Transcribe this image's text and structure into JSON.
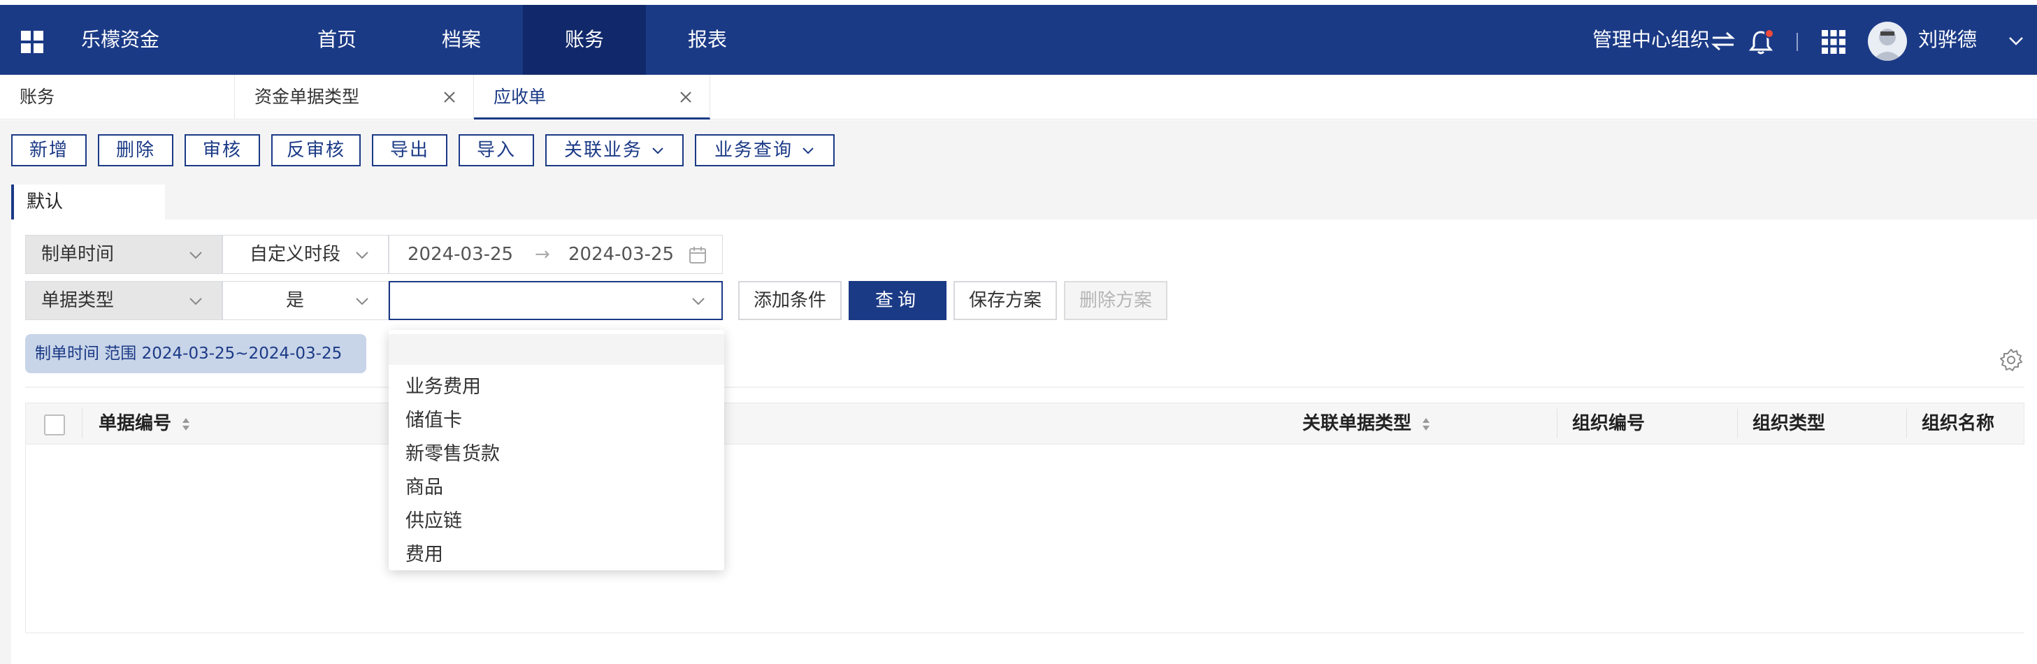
{
  "topbar": {
    "brand": "乐檬资金",
    "nav": [
      {
        "label": "首页",
        "active": false
      },
      {
        "label": "档案",
        "active": false
      },
      {
        "label": "账务",
        "active": true
      },
      {
        "label": "报表",
        "active": false
      }
    ],
    "org": "管理中心组织",
    "username": "刘骅德",
    "icons": [
      "grid-menu-icon",
      "swap-icon",
      "bell-icon",
      "apps-icon",
      "avatar",
      "chevron-down-icon"
    ],
    "colors": {
      "bar": "#1b3a86",
      "active": "#11296a",
      "badge": "#f04a3a"
    }
  },
  "tabs": [
    {
      "label": "账务",
      "closable": false,
      "active": false
    },
    {
      "label": "资金单据类型",
      "closable": true,
      "active": false
    },
    {
      "label": "应收单",
      "closable": true,
      "active": true
    }
  ],
  "toolbar": {
    "buttons": [
      "新增",
      "删除",
      "审核",
      "反审核",
      "导出",
      "导入"
    ],
    "dropdowns": [
      "关联业务",
      "业务查询"
    ]
  },
  "scheme": {
    "label": "默认"
  },
  "filters": {
    "row1": {
      "field": "制单时间",
      "operator": "自定义时段",
      "date_start": "2024-03-25",
      "date_end": "2024-03-25",
      "arrow": "→"
    },
    "row2": {
      "field": "单据类型",
      "operator": "是",
      "value": ""
    },
    "buttons": {
      "add": "添加条件",
      "query": "查询",
      "save": "保存方案",
      "delete": "删除方案"
    },
    "chip": "制单时间 范围 2024-03-25~2024-03-25"
  },
  "table": {
    "columns": [
      "单据编号",
      "关联单据类型",
      "组织编号",
      "组织类型",
      "组织名称"
    ]
  },
  "dropdown": {
    "options": [
      "业务费用",
      "储值卡",
      "新零售货款",
      "商品",
      "供应链",
      "费用"
    ]
  }
}
